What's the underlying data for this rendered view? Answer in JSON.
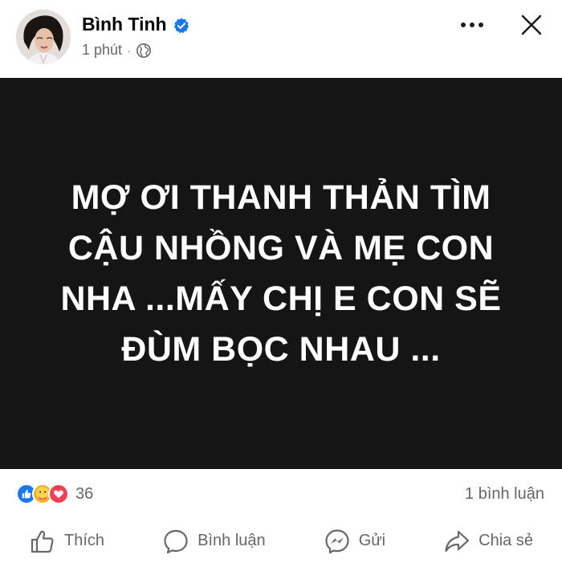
{
  "post": {
    "author": "Bình Tinh",
    "time": "1 phút",
    "separator": "·",
    "image_text_lines": [
      "MỢ ƠI THANH THẢN TÌM",
      "CẬU NHỒNG VÀ MẸ CON",
      "NHA ...MẤY CHỊ E CON SẼ",
      "ĐÙM BỌC NHAU ..."
    ]
  },
  "stats": {
    "reaction_count": "36",
    "comment_count": "1 bình luận"
  },
  "actions": {
    "like": "Thích",
    "comment": "Bình luận",
    "send": "Gửi",
    "share": "Chia sẻ"
  },
  "icons": {
    "verified": "verified-badge-icon",
    "audience": "globe-icon",
    "more": "more-options-icon",
    "close": "close-icon",
    "like": "thumbs-up-icon",
    "comment": "comment-bubble-icon",
    "send": "messenger-icon",
    "share": "share-arrow-icon"
  },
  "colors": {
    "brand_blue": "#1877f2",
    "secondary_text": "#65676b",
    "image_background": "#151515",
    "love_red": "#f33e58",
    "care_yellow": "#f7b125"
  }
}
